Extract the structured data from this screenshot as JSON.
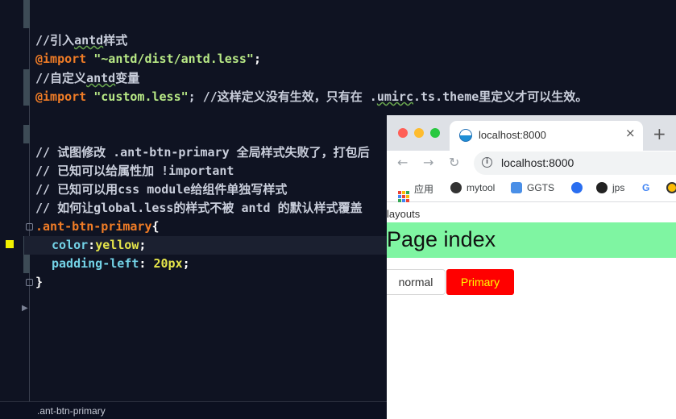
{
  "editor": {
    "lines": {
      "c1": "//引入",
      "c1_word": "antd",
      "c1_tail": "样式",
      "imp1_kw": "@import",
      "imp1_str": "\"~antd/dist/antd.less\"",
      "imp1_end": ";",
      "c2": "//自定义",
      "c2_word": "antd",
      "c2_tail": "变量",
      "imp2_kw": "@import",
      "imp2_str": "\"custom.less\"",
      "imp2_comment_a": "; //这样定义没有生效，只有在 .",
      "imp2_comment_word": "umirc",
      "imp2_comment_b": ".ts.theme里定义才可以生效。",
      "c3": "// 试图修改 .ant-btn-primary 全局样式失败了，打包后",
      "c4": "// 已知可以给属性加 !important",
      "c5": "// 已知可以用css module给组件单独写样式",
      "c6": "// 如何让global.less的样式不被 antd 的默认样式覆盖",
      "selector": ".ant-btn-primary",
      "open_brace": "{",
      "prop1": "color",
      "colon1": ":",
      "val1": "yellow",
      "semi1": ";",
      "prop2": "padding-left",
      "colon2": ": ",
      "val2": "20px",
      "semi2": ";",
      "close_brace": "}"
    },
    "status_text": ".ant-btn-primary"
  },
  "browser": {
    "tab_title": "localhost:8000",
    "tab_close": "×",
    "new_tab": "+",
    "address": "localhost:8000",
    "nav": {
      "back": "←",
      "forward": "→",
      "reload": "↻"
    },
    "bookmarks": [
      "应用",
      "mytool",
      "GGTS",
      "jps"
    ],
    "bookmark_google": "G",
    "page": {
      "layouts_label": "layouts",
      "title": "Page index",
      "btn_normal": "normal",
      "btn_primary": "Primary"
    },
    "colors": {
      "title_bg": "#7ff5a2",
      "primary_bg": "#ff0000",
      "primary_text": "#ffff00"
    }
  }
}
